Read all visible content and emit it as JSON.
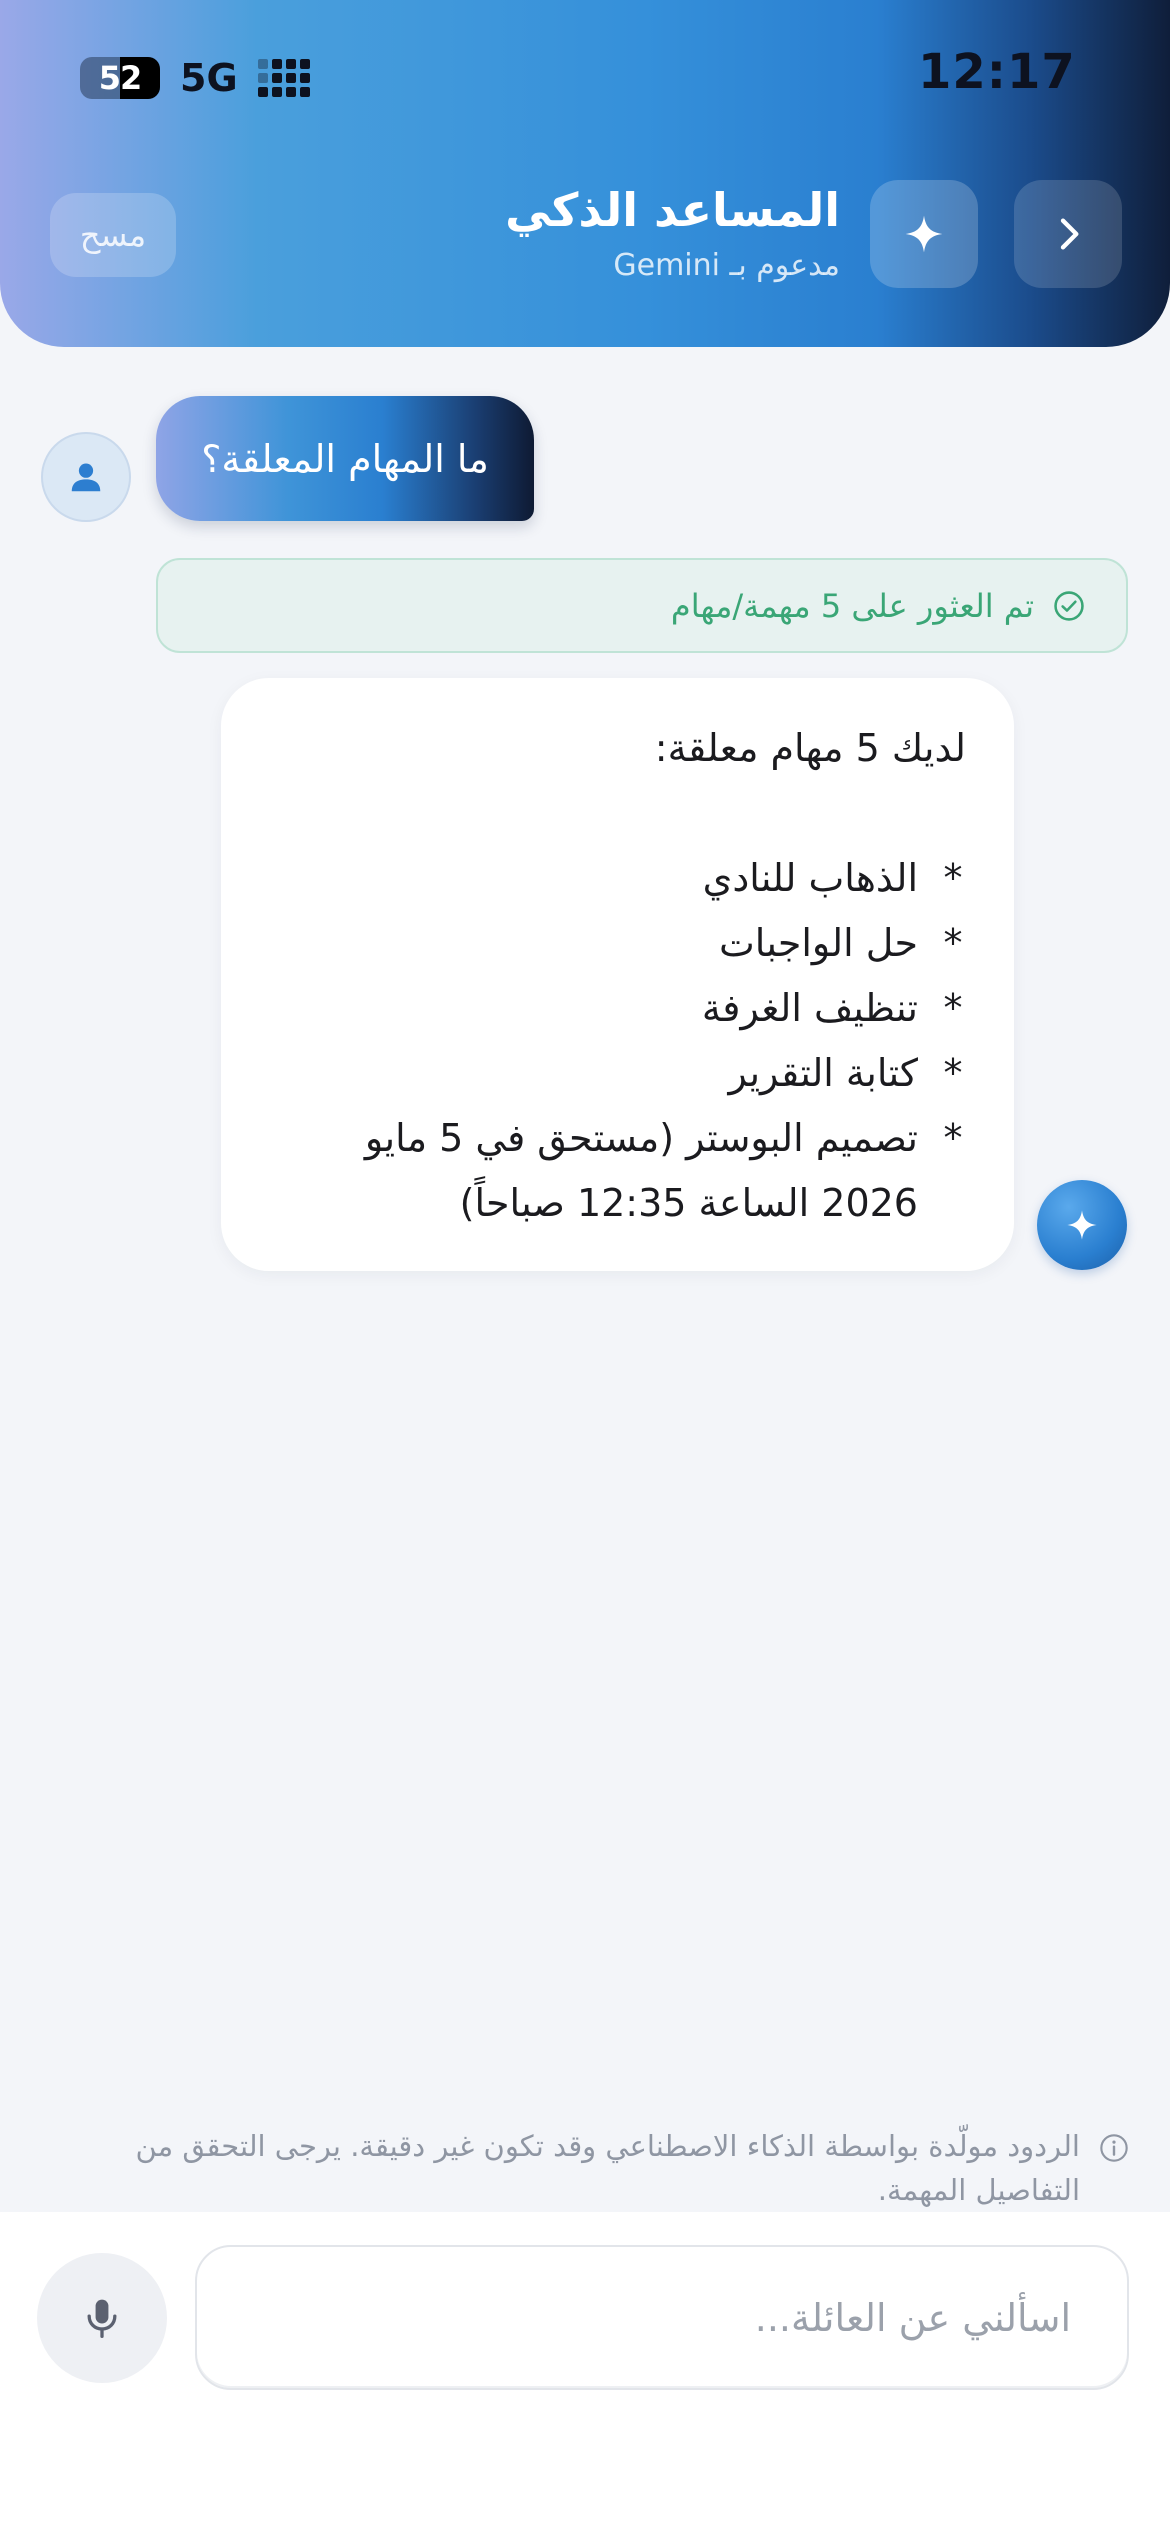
{
  "status_bar": {
    "time": "12:17",
    "battery": "52",
    "network": "5G",
    "signal_icon": "signal-dots-icon"
  },
  "header": {
    "title": "المساعد الذكي",
    "subtitle": "مدعوم بـ Gemini",
    "clear_label": "مسح",
    "back_icon": "chevron-right-icon",
    "spark_icon": "sparkle-icon"
  },
  "chat": {
    "user_message": "ما المهام المعلقة؟",
    "tool_status": "تم العثور على 5 مهمة/مهام",
    "ai_reply": {
      "intro": "لديك 5 مهام معلقة:",
      "items": [
        "الذهاب للنادي",
        "حل الواجبات",
        "تنظيف الغرفة",
        "كتابة التقرير",
        "تصميم البوستر (مستحق في 5 مايو 2026 الساعة 12:35 صباحاً)"
      ],
      "bullet": "*"
    }
  },
  "disclaimer": "الردود مولّدة بواسطة الذكاء الاصطناعي وقد تكون غير دقيقة. يرجى التحقق من التفاصيل المهمة.",
  "composer": {
    "placeholder": "اسألني عن العائلة...",
    "mic_icon": "microphone-icon"
  },
  "colors": {
    "accent": "#2a7fd0",
    "success": "#3aa676",
    "background": "#f3f5f9"
  }
}
